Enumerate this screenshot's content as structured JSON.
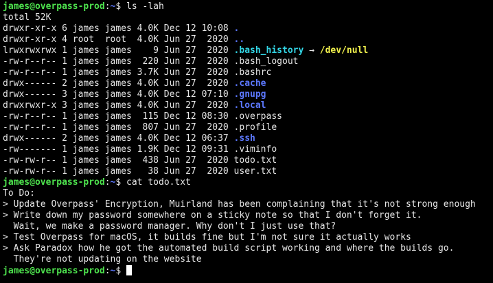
{
  "prompt": {
    "user_host": "james@overpass-prod",
    "separator": ":",
    "path": "~",
    "symbol": "$ "
  },
  "commands": {
    "ls": "ls -lah",
    "cat": "cat todo.txt"
  },
  "colors": {
    "background": "#000000",
    "text": "#e6e6e6",
    "prompt_user": "#4ee44e",
    "directory": "#5c78ff",
    "symlink": "#33d6e6",
    "symlink_target": "#f2f24d"
  },
  "ls_output": {
    "total": "total 52K",
    "entries": [
      {
        "meta": "drwxr-xr-x 6 james james 4.0K Dec 12 10:08 ",
        "name": ".",
        "kind": "dir"
      },
      {
        "meta": "drwxr-xr-x 4 root  root  4.0K Jun 27  2020 ",
        "name": "..",
        "kind": "dir"
      },
      {
        "meta": "lrwxrwxrwx 1 james james    9 Jun 27  2020 ",
        "name": ".bash_history",
        "kind": "link",
        "arrow": " → ",
        "target": "/dev/null"
      },
      {
        "meta": "-rw-r--r-- 1 james james  220 Jun 27  2020 ",
        "name": ".bash_logout",
        "kind": "file"
      },
      {
        "meta": "-rw-r--r-- 1 james james 3.7K Jun 27  2020 ",
        "name": ".bashrc",
        "kind": "file"
      },
      {
        "meta": "drwx------ 2 james james 4.0K Jun 27  2020 ",
        "name": ".cache",
        "kind": "dir"
      },
      {
        "meta": "drwx------ 3 james james 4.0K Dec 12 07:10 ",
        "name": ".gnupg",
        "kind": "dir"
      },
      {
        "meta": "drwxrwxr-x 3 james james 4.0K Jun 27  2020 ",
        "name": ".local",
        "kind": "dir"
      },
      {
        "meta": "-rw-r--r-- 1 james james  115 Dec 12 08:30 ",
        "name": ".overpass",
        "kind": "file"
      },
      {
        "meta": "-rw-r--r-- 1 james james  807 Jun 27  2020 ",
        "name": ".profile",
        "kind": "file"
      },
      {
        "meta": "drwx------ 2 james james 4.0K Dec 12 06:37 ",
        "name": ".ssh",
        "kind": "dir"
      },
      {
        "meta": "-rw------- 1 james james 1.9K Dec 12 09:31 ",
        "name": ".viminfo",
        "kind": "file"
      },
      {
        "meta": "-rw-rw-r-- 1 james james  438 Jun 27  2020 ",
        "name": "todo.txt",
        "kind": "file"
      },
      {
        "meta": "-rw-rw-r-- 1 james james   38 Jun 27  2020 ",
        "name": "user.txt",
        "kind": "file"
      }
    ]
  },
  "todo_output": [
    "To Do:",
    "> Update Overpass' Encryption, Muirland has been complaining that it's not strong enough",
    "> Write down my password somewhere on a sticky note so that I don't forget it.",
    "  Wait, we make a password manager. Why don't I just use that?",
    "> Test Overpass for macOS, it builds fine but I'm not sure it actually works",
    "> Ask Paradox how he got the automated build script working and where the builds go.",
    "  They're not updating on the website"
  ]
}
